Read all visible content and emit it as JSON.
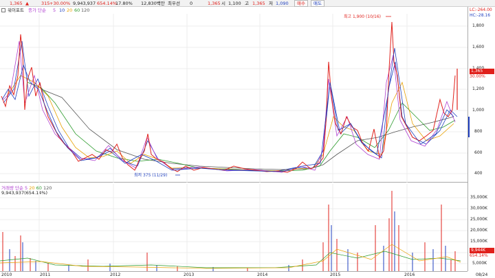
{
  "quote_bar": {
    "price": "1,365",
    "change": "315",
    "change_pct": "+30.00%",
    "volume": "9,943,937",
    "volume_pct": "654.14%",
    "turnover_pct": "17.80%",
    "amount": "12,830백만",
    "ask_label": "최우선",
    "ask_value": "0",
    "close": "1,365",
    "open_label": "시",
    "open": "1,100",
    "high_label": "고",
    "high": "1,365",
    "low_label": "저",
    "low": "1,090",
    "buy_label": "매수",
    "sell_label": "매도"
  },
  "toolbar": {
    "tab_label": "워이포트",
    "ma_label": "종가 단순",
    "ma_periods": [
      "5",
      "10",
      "20",
      "60",
      "120"
    ]
  },
  "volume_legend": {
    "label": "거래량 단순",
    "periods": [
      "5",
      "20",
      "60",
      "120"
    ],
    "value": "9,943,937(654.14%)"
  },
  "annotations": {
    "high_note": "최고 1,900 (10/16)",
    "low_note": "최저 375 (11/29)"
  },
  "right_axis": {
    "lc": "LC:-264.00",
    "hc": "HC:-28.16",
    "price_ticks": [
      "1,800",
      "1,600",
      "1,400",
      "1,200",
      "1,000",
      "800",
      "600",
      "400"
    ],
    "current_price": "1,365",
    "current_pct": "30.00%",
    "volume_ticks": [
      "35,000K",
      "30,000K",
      "25,000K",
      "20,000K",
      "15,000K",
      "10,000K",
      "5,000K"
    ],
    "current_volume": "9,944K",
    "current_volume_pct": "654.14%"
  },
  "x_axis": [
    "2010",
    "2011",
    "2012",
    "2013",
    "2014",
    "2015",
    "2016",
    "08/24"
  ],
  "colors": {
    "price_up": "#e0201b",
    "price_down": "#1f3fbf",
    "ma5": "#b040d0",
    "ma10": "#1f3fbf",
    "ma20": "#e8a000",
    "ma60": "#2a9a2a",
    "ma120": "#555555"
  }
}
